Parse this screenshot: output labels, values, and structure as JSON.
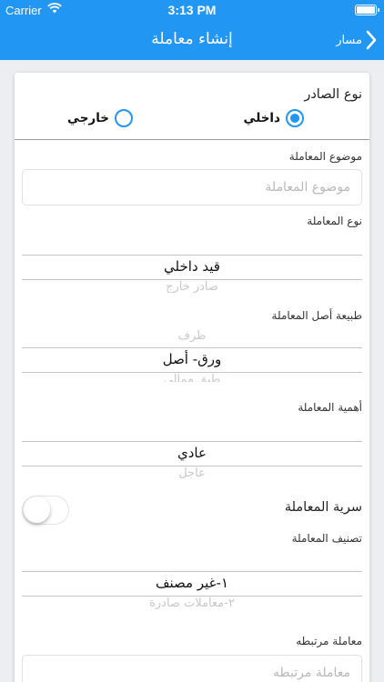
{
  "status_bar": {
    "carrier": "Carrier",
    "time": "3:13 PM"
  },
  "nav": {
    "title": "إنشاء معاملة",
    "back_label": "مسار"
  },
  "colors": {
    "primary": "#2196f3"
  },
  "form": {
    "issuer_type": {
      "label": "نوع الصادر",
      "options": [
        "داخلي",
        "خارجي"
      ],
      "selected": "داخلي"
    },
    "subject": {
      "label": "موضوع المعاملة",
      "placeholder": "موضوع المعاملة",
      "value": ""
    },
    "transaction_type": {
      "label": "نوع المعاملة",
      "selected": "قيد داخلي",
      "next_option": "صادر خارج"
    },
    "original_nature": {
      "label": "طبيعة أصل المعاملة",
      "prev_option": "ظرف",
      "selected": "ورق- أصل",
      "next_option": "طبق ممالي"
    },
    "importance": {
      "label": "أهمية المعاملة",
      "selected": "عادي",
      "next_option": "عاجل"
    },
    "confidentiality": {
      "label": "سرية المعاملة",
      "enabled": false
    },
    "classification": {
      "label": "تصنيف المعاملة",
      "selected": "١-غير مصنف",
      "next_option": "٢-معاملات صادرة"
    },
    "related": {
      "label": "معاملة مرتبطه",
      "placeholder": "معاملة مرتبطه",
      "value": ""
    }
  }
}
